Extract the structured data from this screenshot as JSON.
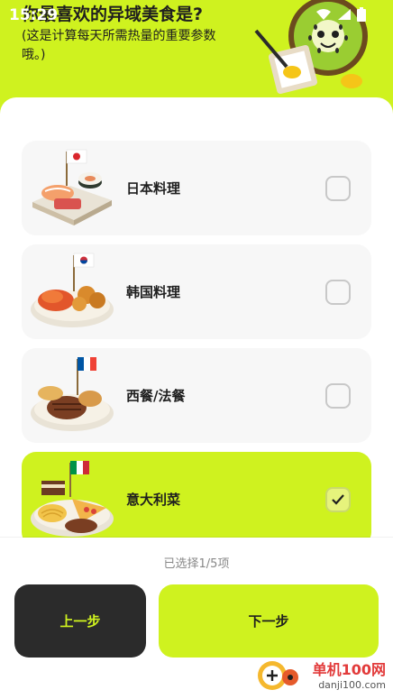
{
  "status": {
    "time": "15:29",
    "icons": [
      "wifi-icon",
      "signal-icon",
      "battery-icon"
    ]
  },
  "question": {
    "title": "你最喜欢的异域美食是?",
    "subtitle": "(这是计算每天所需热量的重要参数哦。)"
  },
  "options": [
    {
      "label": "日本料理",
      "flag": "japan-flag-icon",
      "selected": false
    },
    {
      "label": "韩国料理",
      "flag": "korea-flag-icon",
      "selected": false
    },
    {
      "label": "西餐/法餐",
      "flag": "france-flag-icon",
      "selected": false
    },
    {
      "label": "意大利菜",
      "flag": "italy-flag-icon",
      "selected": true
    }
  ],
  "footer": {
    "count_text": "已选择1/5项",
    "prev_label": "上一步",
    "next_label": "下一步"
  },
  "watermark": {
    "text": "单机100网",
    "url": "danji100.com"
  },
  "colors": {
    "accent": "#cff21f",
    "dark": "#2b2b2b",
    "card": "#f7f7f7"
  }
}
